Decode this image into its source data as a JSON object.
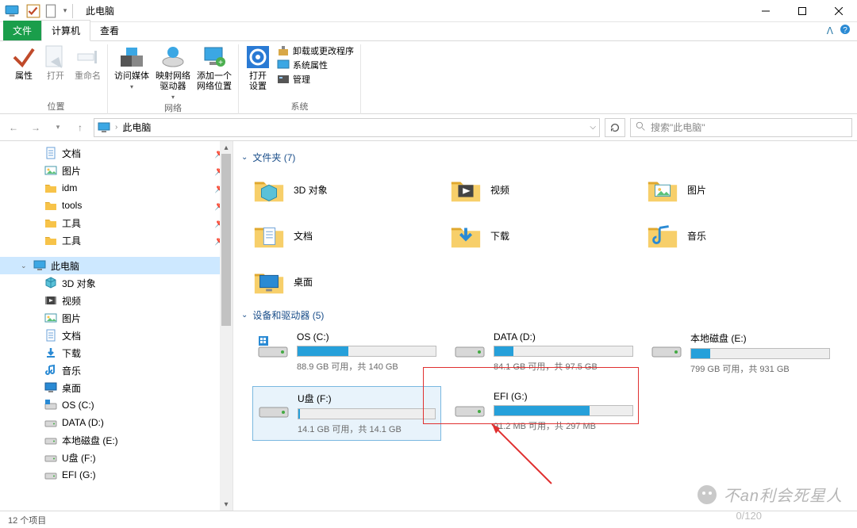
{
  "title": "此电脑",
  "tabs": {
    "file": "文件",
    "computer": "计算机",
    "view": "查看"
  },
  "ribbon": {
    "loc": {
      "props": "属性",
      "open": "打开",
      "rename": "重命名",
      "group": "位置"
    },
    "net": {
      "media": "访问媒体",
      "map": "映射网络\n驱动器",
      "addloc": "添加一个\n网络位置",
      "group": "网络"
    },
    "sys": {
      "opensettings": "打开\n设置",
      "uninstall": "卸载或更改程序",
      "props": "系统属性",
      "manage": "管理",
      "group": "系统"
    }
  },
  "addr": {
    "root": "此电脑"
  },
  "search": {
    "placeholder": "搜索\"此电脑\""
  },
  "nav": [
    {
      "label": "文档",
      "icon": "doc",
      "pin": true,
      "ind": 34
    },
    {
      "label": "图片",
      "icon": "pic",
      "pin": true,
      "ind": 34
    },
    {
      "label": "idm",
      "icon": "fol",
      "pin": true,
      "ind": 34
    },
    {
      "label": "tools",
      "icon": "fol",
      "pin": true,
      "ind": 34
    },
    {
      "label": "工具",
      "icon": "fol",
      "pin": true,
      "ind": 34
    },
    {
      "label": "工具",
      "icon": "fol",
      "pin": true,
      "ind": 34
    },
    {
      "label": "",
      "icon": "",
      "ind": 0,
      "blank": true
    },
    {
      "label": "此电脑",
      "icon": "pc",
      "ind": 20,
      "sel": true,
      "exp": true
    },
    {
      "label": "3D 对象",
      "icon": "3d",
      "ind": 34
    },
    {
      "label": "视频",
      "icon": "vid",
      "ind": 34
    },
    {
      "label": "图片",
      "icon": "pic",
      "ind": 34
    },
    {
      "label": "文档",
      "icon": "doc",
      "ind": 34
    },
    {
      "label": "下载",
      "icon": "dl",
      "ind": 34
    },
    {
      "label": "音乐",
      "icon": "mus",
      "ind": 34
    },
    {
      "label": "桌面",
      "icon": "desk",
      "ind": 34
    },
    {
      "label": "OS (C:)",
      "icon": "osdrv",
      "ind": 34
    },
    {
      "label": "DATA (D:)",
      "icon": "drv",
      "ind": 34
    },
    {
      "label": "本地磁盘 (E:)",
      "icon": "drv",
      "ind": 34
    },
    {
      "label": "U盘 (F:)",
      "icon": "drv",
      "ind": 34
    },
    {
      "label": "EFI (G:)",
      "icon": "drv",
      "ind": 34
    }
  ],
  "sections": {
    "folders": {
      "title": "文件夹 (7)",
      "items": [
        {
          "label": "3D 对象",
          "icon": "3d"
        },
        {
          "label": "视频",
          "icon": "vid"
        },
        {
          "label": "图片",
          "icon": "pic"
        },
        {
          "label": "文档",
          "icon": "doc"
        },
        {
          "label": "下载",
          "icon": "dl"
        },
        {
          "label": "音乐",
          "icon": "mus"
        },
        {
          "label": "桌面",
          "icon": "desk"
        }
      ]
    },
    "drives": {
      "title": "设备和驱动器 (5)",
      "items": [
        {
          "name": "OS (C:)",
          "stat": "88.9 GB 可用，共 140 GB",
          "pct": 37,
          "os": true
        },
        {
          "name": "DATA (D:)",
          "stat": "84.1 GB 可用，共 97.5 GB",
          "pct": 14
        },
        {
          "name": "本地磁盘 (E:)",
          "stat": "799 GB 可用，共 931 GB",
          "pct": 14
        },
        {
          "name": "U盘 (F:)",
          "stat": "14.1 GB 可用，共 14.1 GB",
          "pct": 1,
          "sel": true
        },
        {
          "name": "EFI (G:)",
          "stat": "91.2 MB 可用，共 297 MB",
          "pct": 69
        }
      ]
    }
  },
  "status": {
    "count": "12 个项目"
  },
  "watermark": "不an利会死星人",
  "page": "0/120"
}
